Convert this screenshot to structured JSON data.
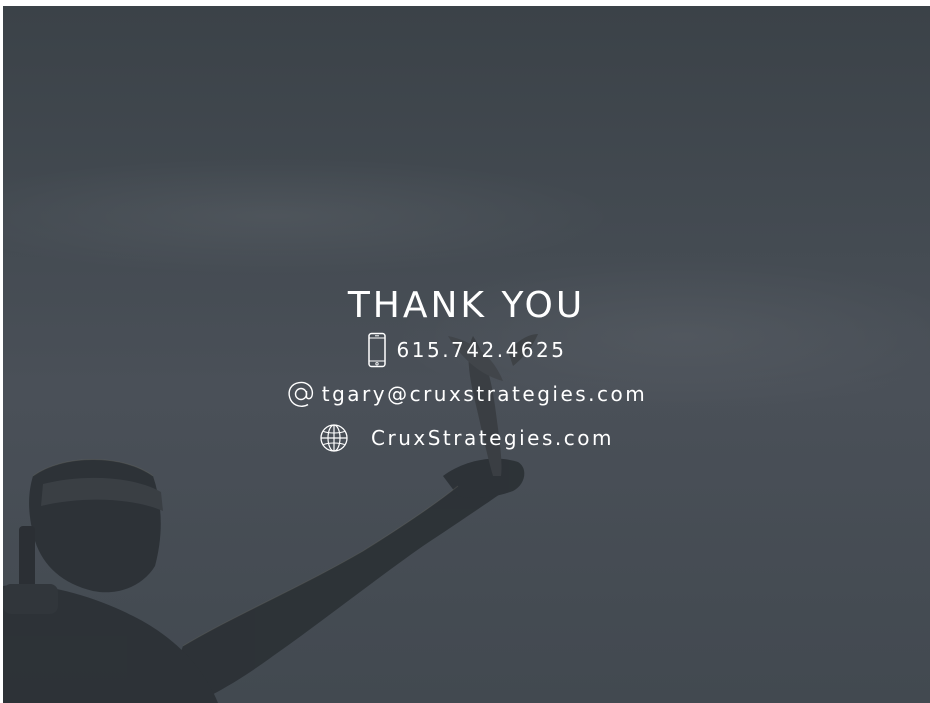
{
  "slide": {
    "title": "THANK YOU",
    "contacts": [
      {
        "icon": "phone-icon",
        "text": "615.742.4625"
      },
      {
        "icon": "at-sign-icon",
        "text": "tgary@cruxstrategies.com"
      },
      {
        "icon": "globe-icon",
        "text": "CruxStrategies.com"
      }
    ]
  },
  "colors": {
    "overlay": "#434a51",
    "text": "#ffffff"
  }
}
